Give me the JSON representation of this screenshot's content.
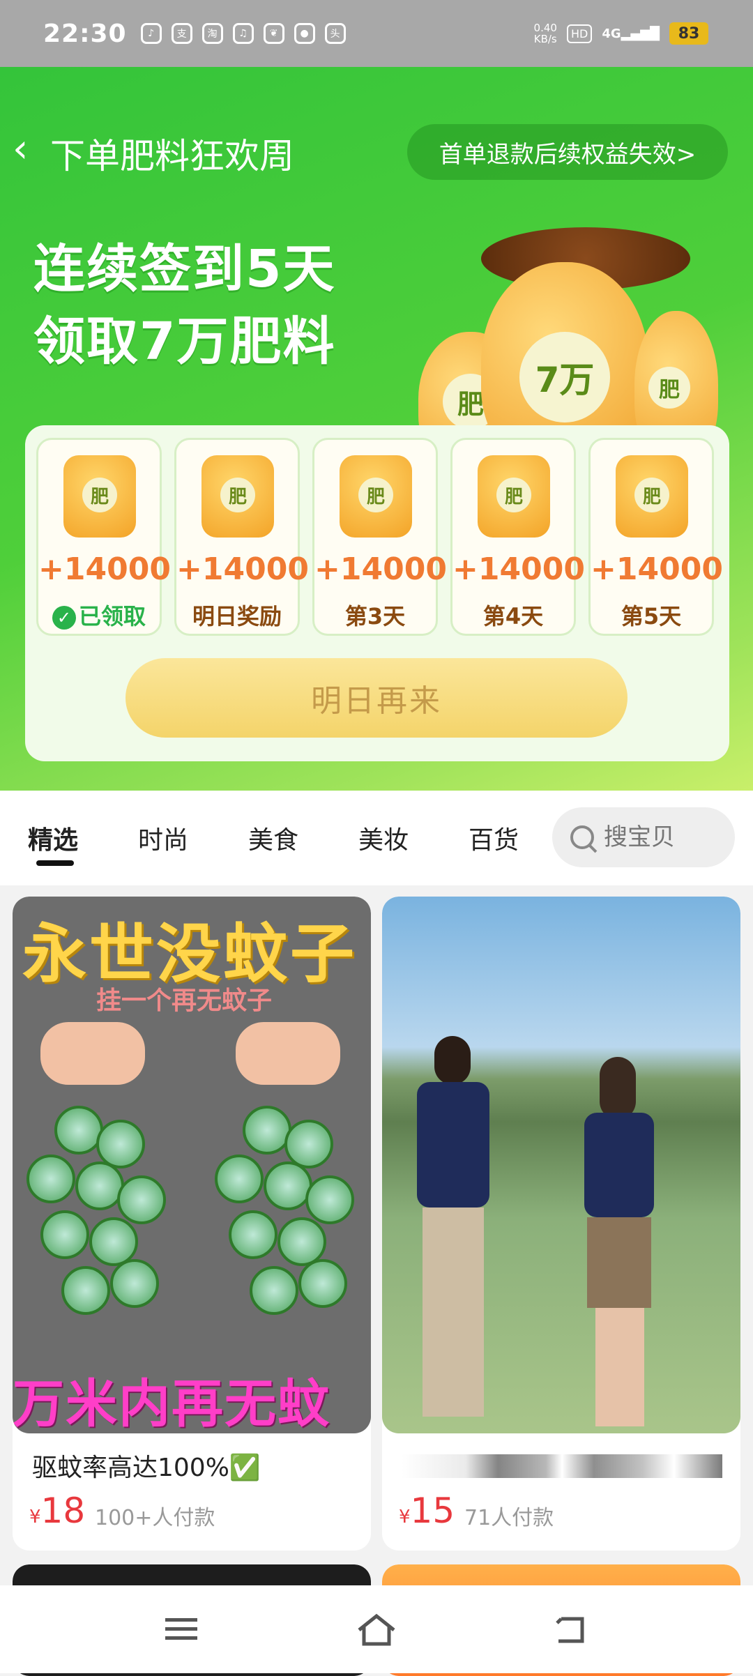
{
  "status_bar": {
    "time": "22:30",
    "speed": "0.40",
    "speed_unit": "KB/s",
    "hd": "HD",
    "network": "4G",
    "battery": "83"
  },
  "header": {
    "title": "下单肥料狂欢周",
    "refund_link": "首单退款后续权益失效>"
  },
  "promo": {
    "line1": "连续签到5天",
    "line2": "领取7万肥料",
    "bag_label_main": "7万",
    "bag_label_side": "肥"
  },
  "checkin": {
    "days": [
      {
        "bag_label": "肥",
        "amount": "+14000",
        "label": "已领取",
        "claimed": true
      },
      {
        "bag_label": "肥",
        "amount": "+14000",
        "label": "明日奖励",
        "claimed": false
      },
      {
        "bag_label": "肥",
        "amount": "+14000",
        "label": "第3天",
        "claimed": false
      },
      {
        "bag_label": "肥",
        "amount": "+14000",
        "label": "第4天",
        "claimed": false
      },
      {
        "bag_label": "肥",
        "amount": "+14000",
        "label": "第5天",
        "claimed": false
      }
    ],
    "button_label": "明日再来"
  },
  "tabs": {
    "items": [
      "精选",
      "时尚",
      "美食",
      "美妆",
      "百货"
    ],
    "active_index": 0,
    "search_placeholder": "搜宝贝"
  },
  "products": [
    {
      "image_text_top": "永世没蚊子",
      "image_text_sub": "挂一个再无蚊子",
      "image_text_bottom": "万米内再无蚊子",
      "title": "驱蚊率高达100%✅",
      "currency": "¥",
      "price": "18",
      "paid": "100+人付款"
    },
    {
      "title": "",
      "currency": "¥",
      "price": "15",
      "paid": "71人付款"
    }
  ],
  "colors": {
    "hero_green": "#34c43a",
    "price_red": "#e8383d",
    "amount_orange": "#f07a32",
    "claimed_green": "#29b24a"
  }
}
